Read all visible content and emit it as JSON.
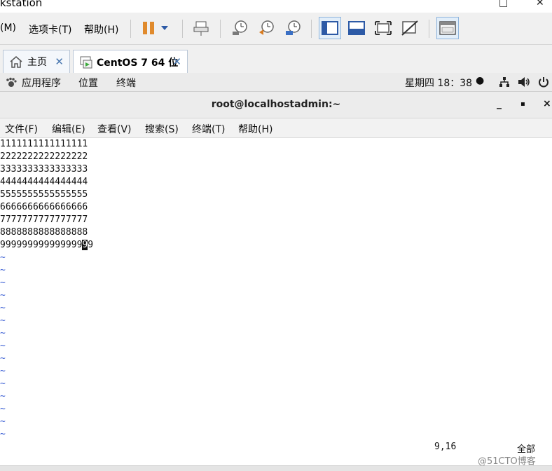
{
  "app": {
    "title": "kstation",
    "minimize": "—",
    "maximize": "□",
    "close": "✕"
  },
  "vm_menu": {
    "items": [
      "(M)",
      "选项卡(T)",
      "帮助(H)"
    ]
  },
  "toolbar": {
    "pause_icon": "pause-icon",
    "dropdown_icon": "chevron-down-icon",
    "icons": [
      "send-ctrl-alt-del-icon",
      "snapshot-take-icon",
      "snapshot-revert-icon",
      "snapshot-manager-icon",
      "console-view-icon",
      "quick-switch-icon",
      "fullscreen-icon",
      "unity-icon",
      "library-view-icon"
    ]
  },
  "tabs": [
    {
      "label": "主页",
      "icon": "home-icon",
      "close": "✕"
    },
    {
      "label": "CentOS 7 64 位",
      "icon": "vm-icon",
      "close": "✕"
    }
  ],
  "gnome": {
    "apps": "应用程序",
    "places": "位置",
    "terminal": "终端",
    "clock": "星期四 18：38",
    "status_dot": "●"
  },
  "terminal": {
    "title": "root@localhostadmin:~",
    "minimize": "_",
    "maximize": "▪",
    "close": "×",
    "menu": [
      "文件(F)",
      "编辑(E)",
      "查看(V)",
      "搜索(S)",
      "终端(T)",
      "帮助(H)"
    ]
  },
  "vim": {
    "lines": [
      "1111111111111111",
      "2222222222222222",
      "3333333333333333",
      "4444444444444444",
      "5555555555555555",
      "6666666666666666",
      "7777777777777777",
      "8888888888888888"
    ],
    "last_line_before": "999999999999999",
    "last_line_cursor": "9",
    "last_line_after": "9",
    "tilde": "~",
    "position": "9,16",
    "scope": "全部"
  },
  "watermark": "@51CTO博客",
  "colors": {
    "accent": "#4a78b0",
    "tilde": "#3b5fd4",
    "pause": "#e08a2c"
  }
}
